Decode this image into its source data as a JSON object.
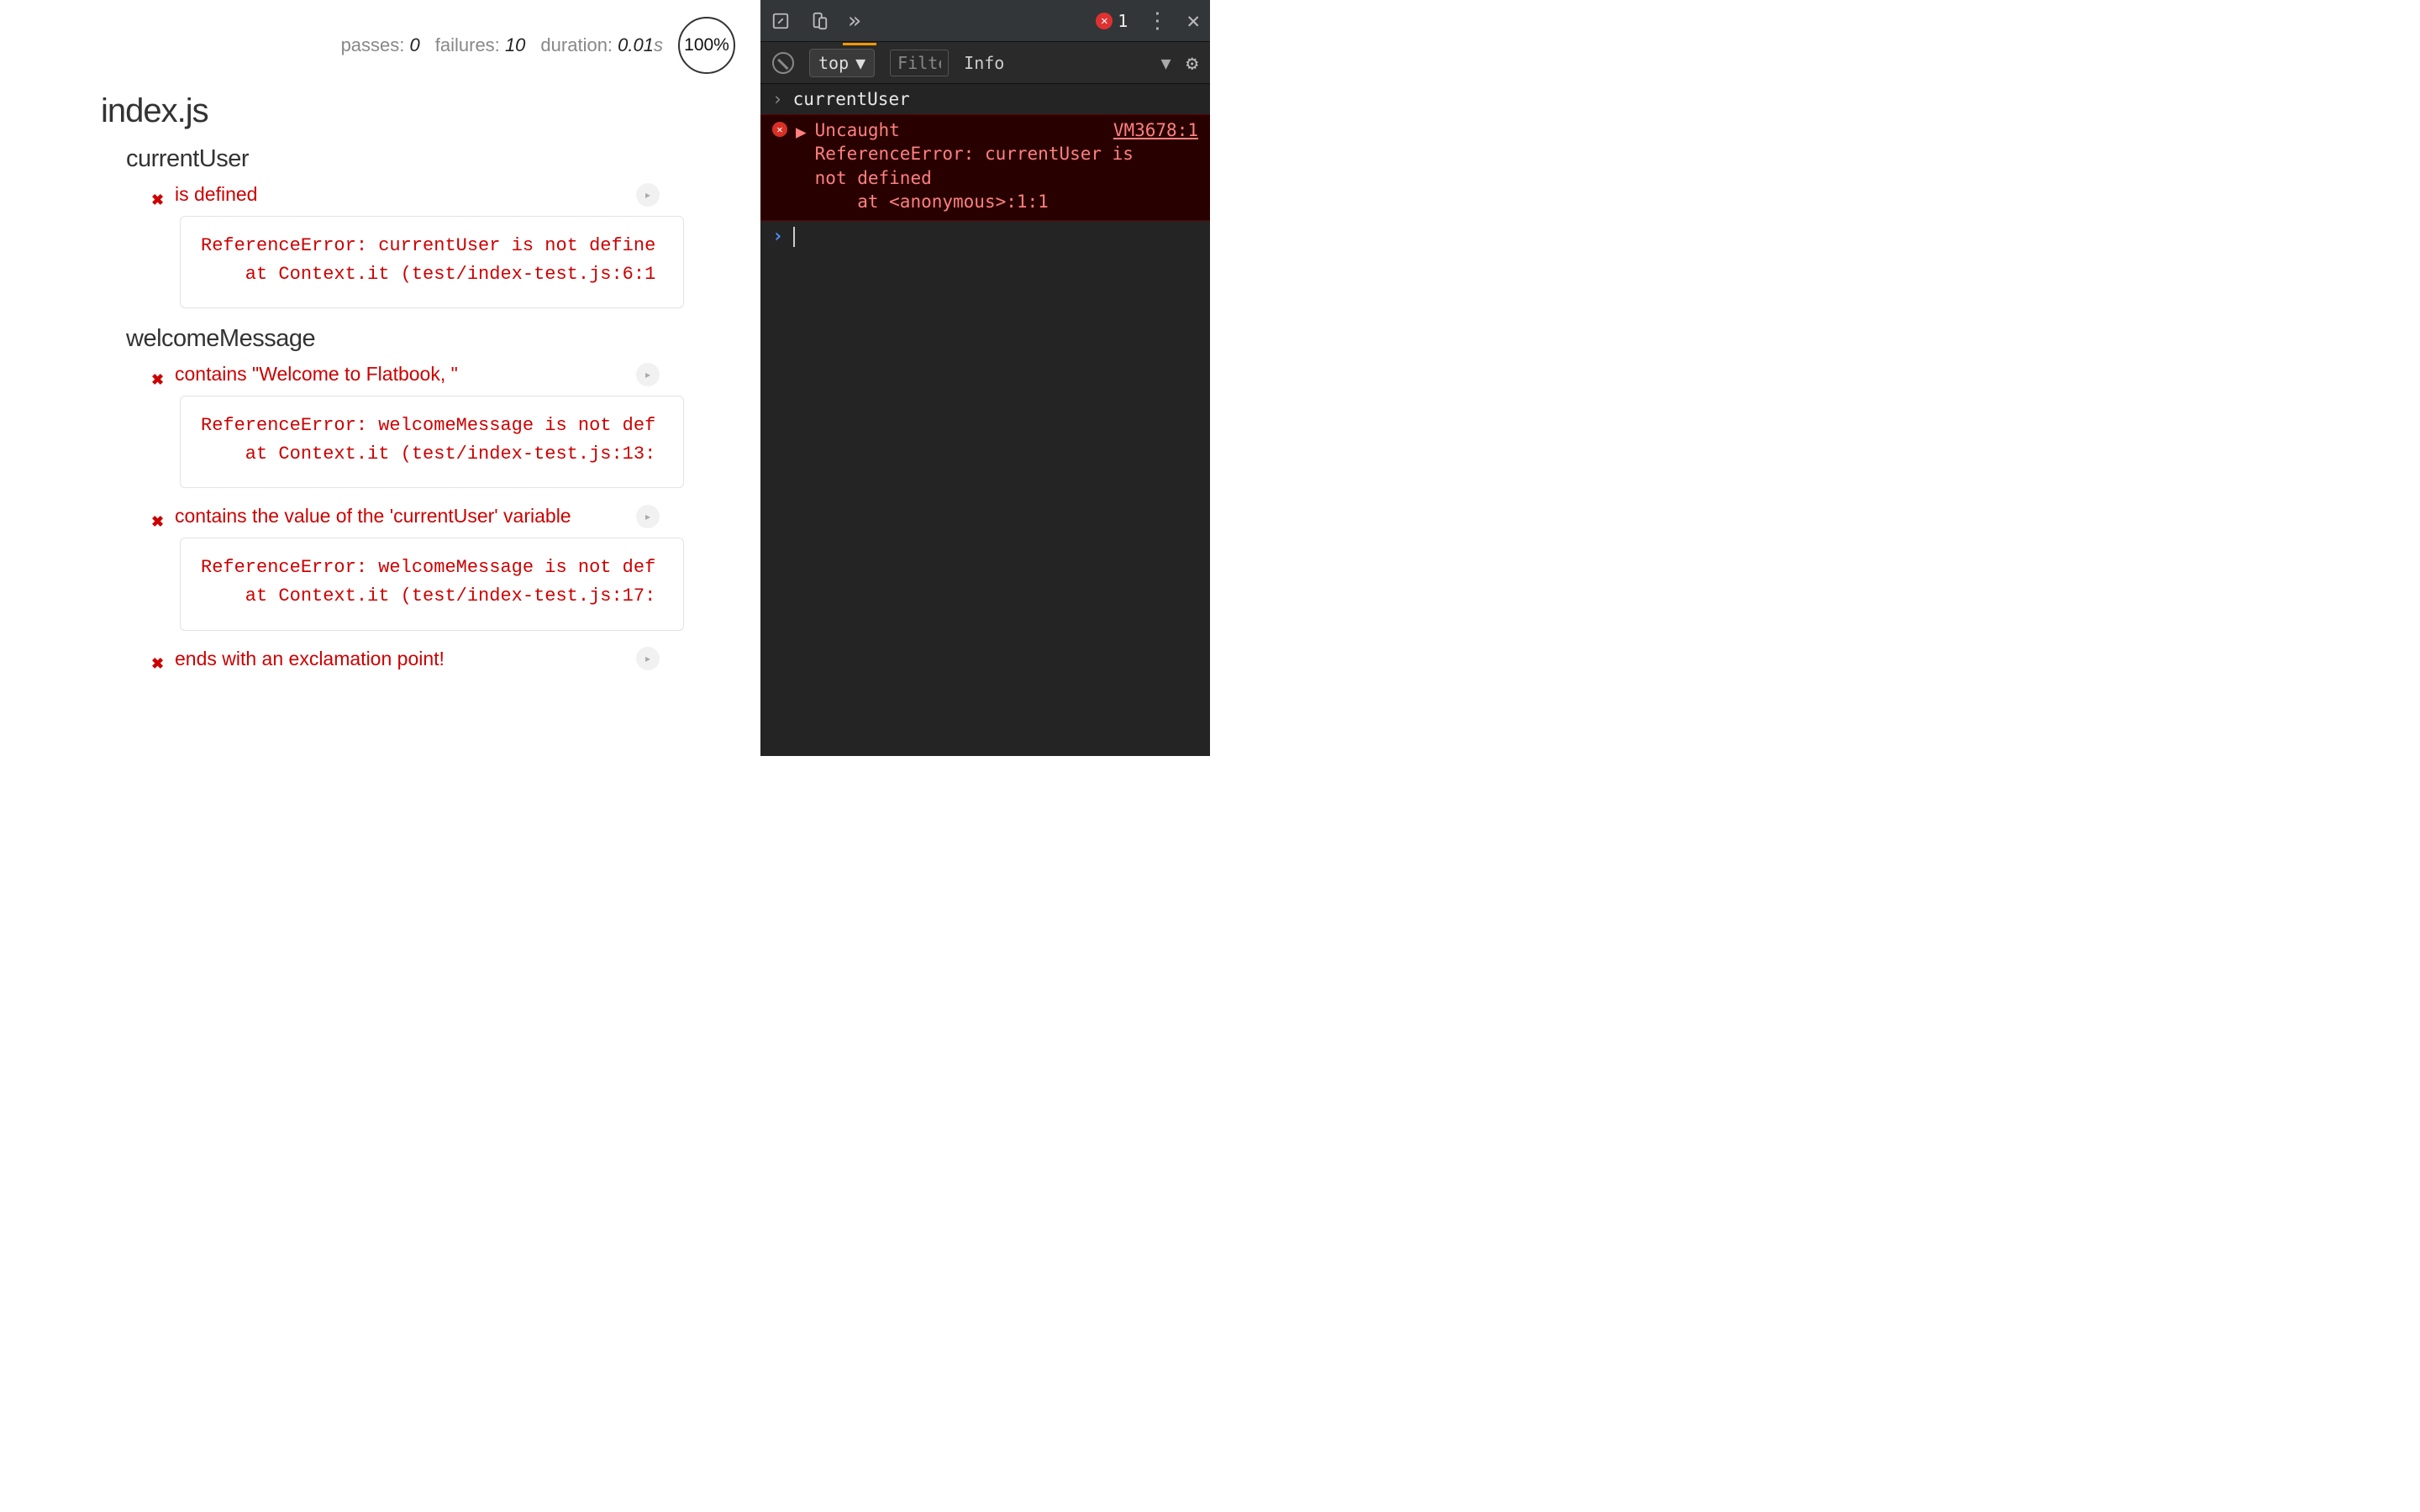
{
  "mocha": {
    "stats": {
      "passes_label": "passes:",
      "passes": "0",
      "failures_label": "failures:",
      "failures": "10",
      "duration_label": "duration:",
      "duration_value": "0.01",
      "duration_unit": "s",
      "progress": "100%"
    },
    "root_suite": "index.js",
    "suites": [
      {
        "name": "currentUser",
        "tests": [
          {
            "title": "is defined",
            "error_line1": "ReferenceError: currentUser is not define",
            "error_line2": "    at Context.it (test/index-test.js:6:1"
          }
        ]
      },
      {
        "name": "welcomeMessage",
        "tests": [
          {
            "title": "contains \"Welcome to Flatbook, \"",
            "error_line1": "ReferenceError: welcomeMessage is not def",
            "error_line2": "    at Context.it (test/index-test.js:13:"
          },
          {
            "title": "contains the value of the 'currentUser' variable",
            "error_line1": "ReferenceError: welcomeMessage is not def",
            "error_line2": "    at Context.it (test/index-test.js:17:"
          },
          {
            "title": "ends with an exclamation point!",
            "error_line1": "",
            "error_line2": ""
          }
        ]
      }
    ]
  },
  "devtools": {
    "error_count": "1",
    "context": "top",
    "filter_placeholder": "Filter",
    "info_label": "Info",
    "input_echo": "currentUser",
    "error": {
      "heading": "Uncaught",
      "body": "ReferenceError: currentUser is\nnot defined\n    at <anonymous>:1:1",
      "source": "VM3678:1"
    }
  }
}
